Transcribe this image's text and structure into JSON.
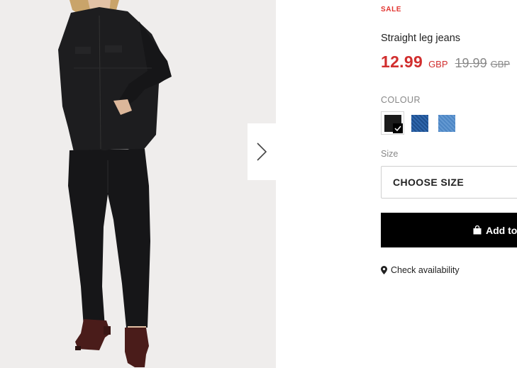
{
  "product": {
    "badge": "SALE",
    "name": "Straight leg jeans",
    "price": {
      "current": "12.99",
      "currency": "GBP",
      "original": "19.99",
      "original_currency": "GBP"
    },
    "image_alt": "Model wearing black denim jacket and straight leg jeans"
  },
  "colour": {
    "label": "COLOUR",
    "swatches": [
      {
        "name": "black",
        "color": "#1b1b1b",
        "selected": true
      },
      {
        "name": "dark denim",
        "color": "#2a5ea3",
        "selected": false
      },
      {
        "name": "light denim",
        "color": "#5a92cc",
        "selected": false
      }
    ]
  },
  "size": {
    "label": "Size",
    "placeholder": "CHOOSE SIZE"
  },
  "cart": {
    "add_label": "Add to"
  },
  "store": {
    "availability_label": "Check availability"
  },
  "icons": {
    "next": "chevron-right-icon",
    "check": "check-icon",
    "bag": "shopping-bag-icon",
    "location": "map-pin-icon"
  },
  "colors": {
    "sale_red": "#d12e2e",
    "button_black": "#000000",
    "gallery_bg": "#efedec"
  }
}
